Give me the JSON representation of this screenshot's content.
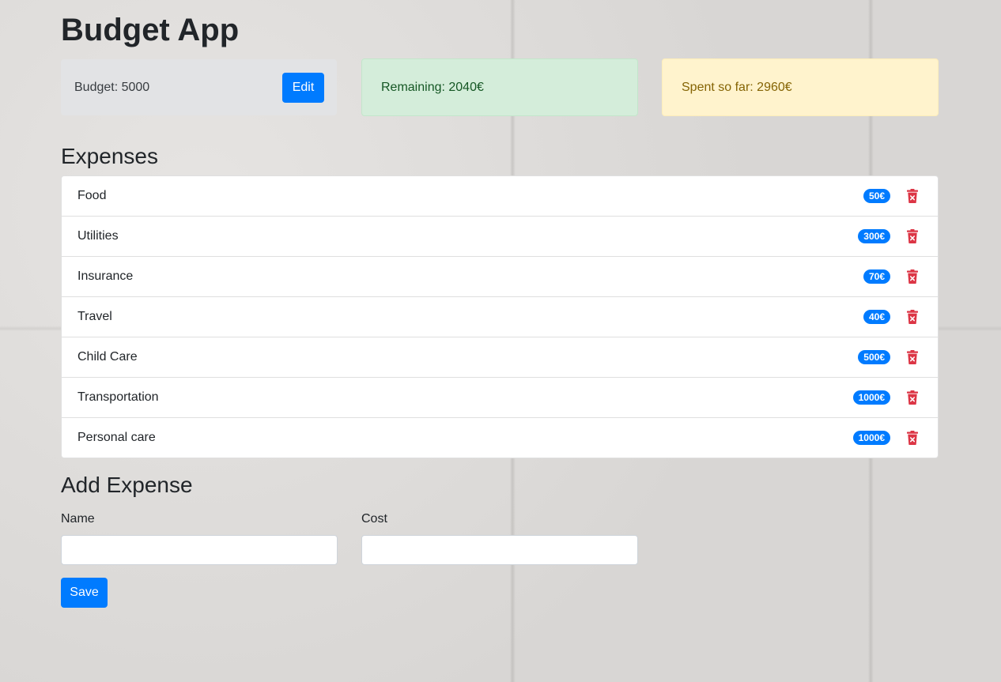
{
  "app": {
    "title": "Budget App"
  },
  "summary": {
    "budget_text": "Budget: 5000",
    "edit_label": "Edit",
    "remaining_text": "Remaining: 2040€",
    "spent_text": "Spent so far: 2960€"
  },
  "expenses": {
    "heading": "Expenses",
    "items": [
      {
        "name": "Food",
        "cost": "50€"
      },
      {
        "name": "Utilities",
        "cost": "300€"
      },
      {
        "name": "Insurance",
        "cost": "70€"
      },
      {
        "name": "Travel",
        "cost": "40€"
      },
      {
        "name": "Child Care",
        "cost": "500€"
      },
      {
        "name": "Transportation",
        "cost": "1000€"
      },
      {
        "name": "Personal care",
        "cost": "1000€"
      }
    ]
  },
  "form": {
    "heading": "Add Expense",
    "name_label": "Name",
    "name_value": "",
    "cost_label": "Cost",
    "cost_value": "",
    "save_label": "Save"
  },
  "icons": {
    "delete": "trash-icon"
  },
  "colors": {
    "primary": "#007bff",
    "danger": "#dc3545",
    "remaining_bg": "#d4edda",
    "spent_bg": "#fff3cd",
    "budget_bg": "#e2e3e5"
  }
}
